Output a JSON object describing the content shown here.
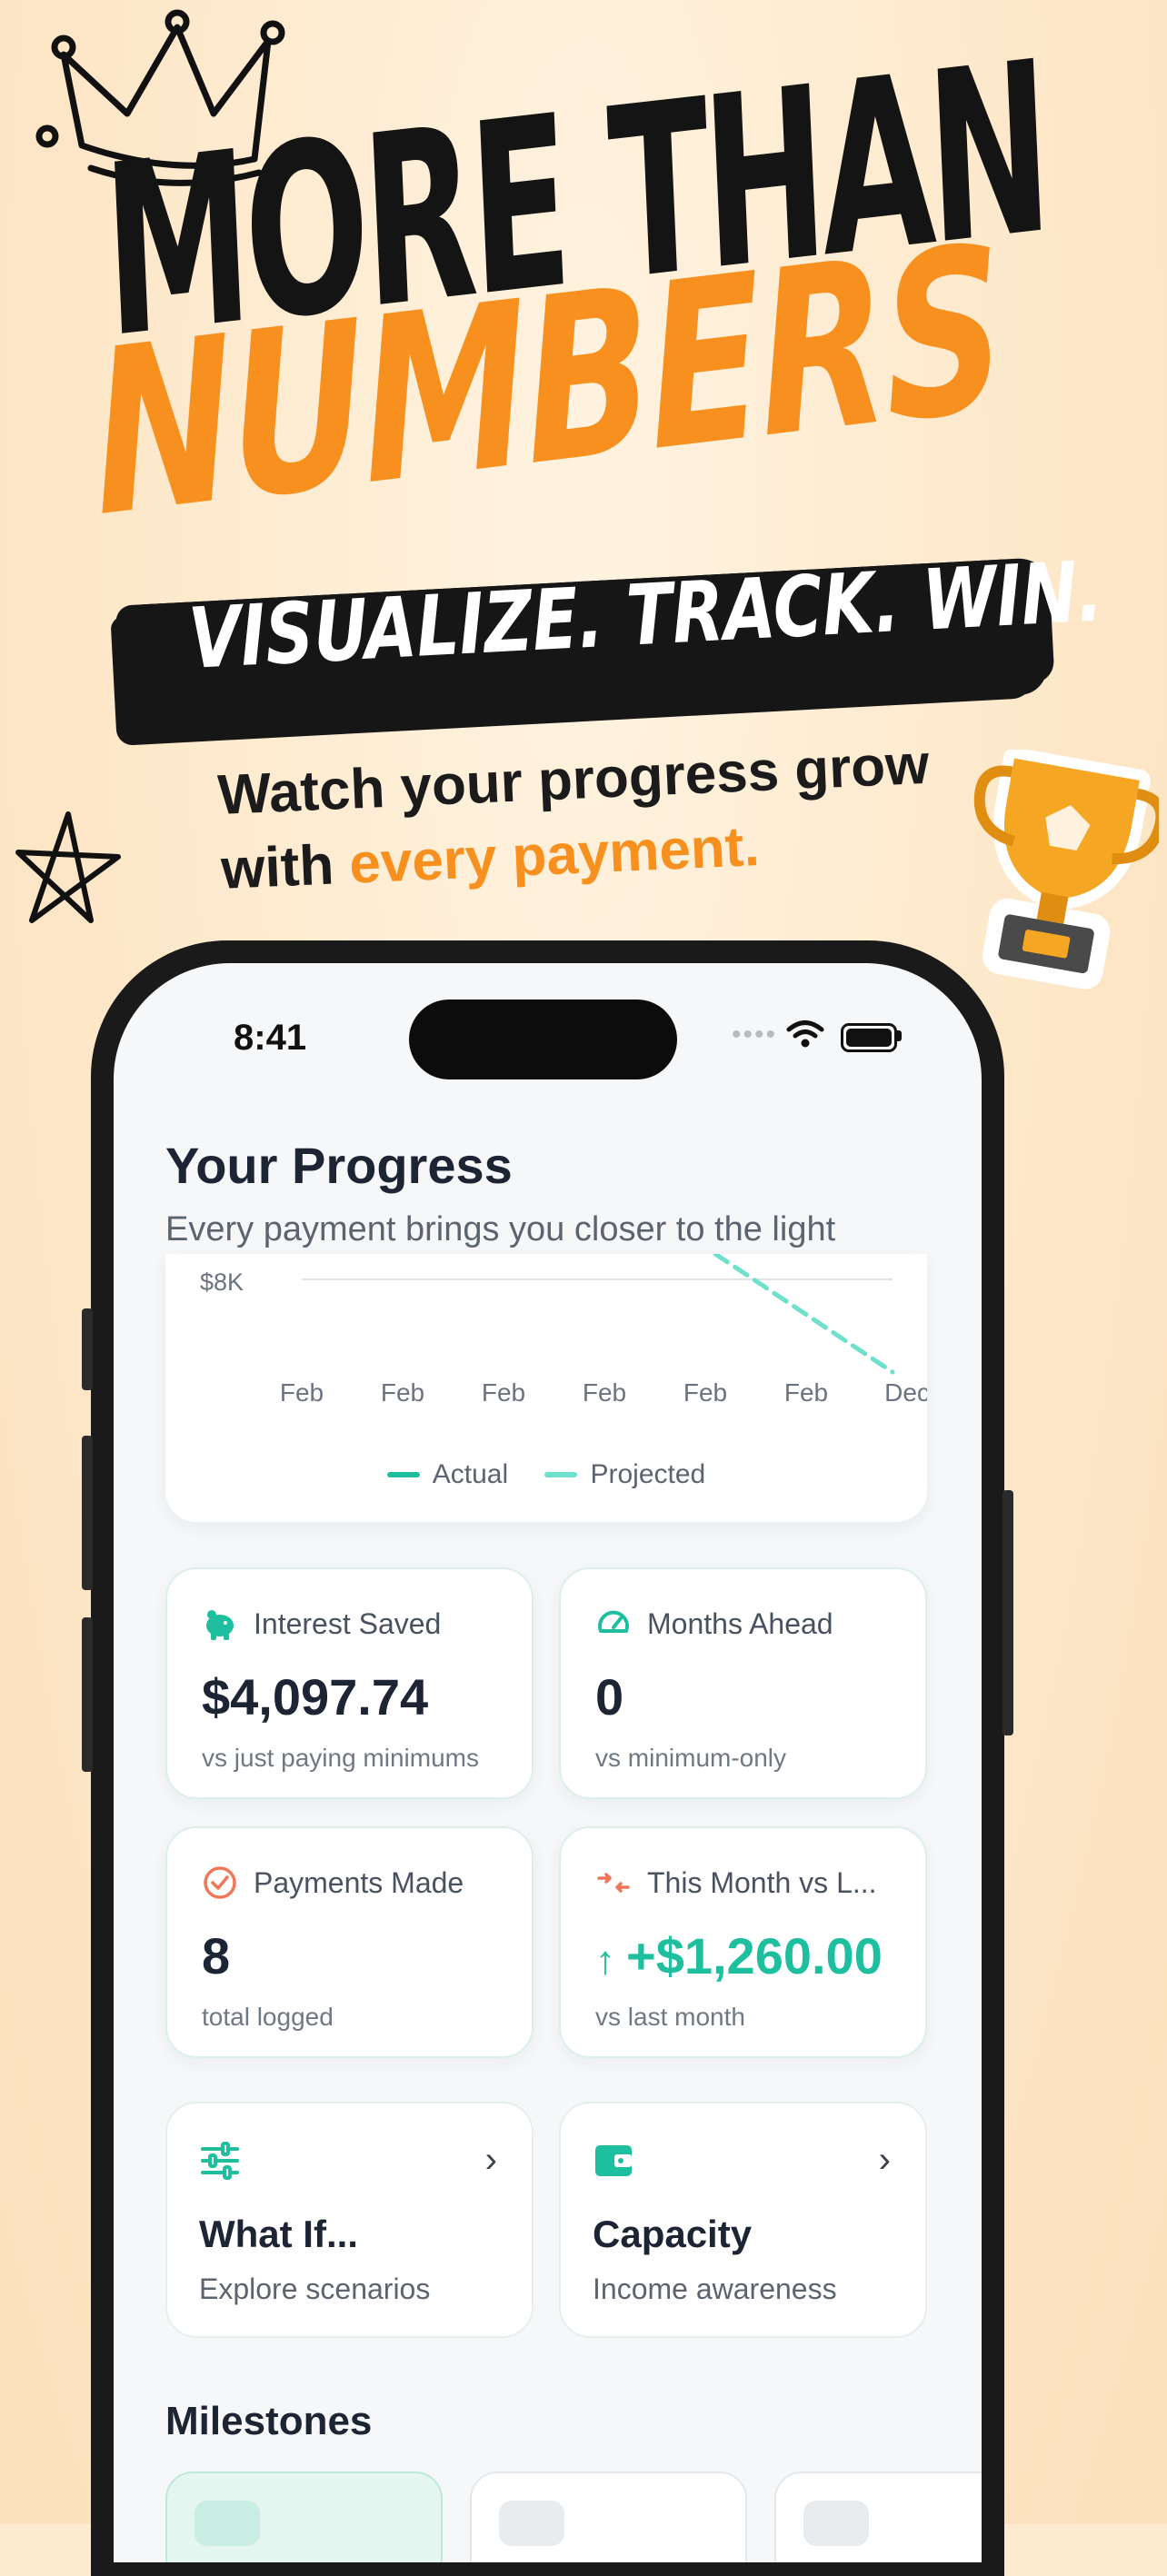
{
  "headline": {
    "line1": "MORE THAN",
    "line2": "NUMBERS",
    "tagline": "VISUALIZE. TRACK. WIN.",
    "sub_line1": "Watch your progress grow",
    "sub_line2_prefix": "with ",
    "sub_line2_highlight": "every payment."
  },
  "decorations": [
    "crown-doodle-icon",
    "star-doodle-icon",
    "trophy-sticker-icon"
  ],
  "colors": {
    "background": "#fdebcf",
    "accent_orange": "#f7901e",
    "teal": "#1dbf9f",
    "dark": "#1d2433"
  },
  "status_bar": {
    "time": "8:41",
    "icons": [
      "signal-dots-icon",
      "wifi-icon",
      "battery-icon"
    ]
  },
  "page": {
    "title": "Your Progress",
    "subtitle": "Every payment brings you closer to the light"
  },
  "chart_data": {
    "type": "line",
    "ytick_labels": [
      "$8K"
    ],
    "x": [
      "Feb",
      "Feb",
      "Feb",
      "Feb",
      "Feb",
      "Feb",
      "Dec"
    ],
    "series": [
      {
        "name": "Actual",
        "color": "#1dbf9f",
        "style": "solid"
      },
      {
        "name": "Projected",
        "color": "#6fe0cc",
        "style": "dashed"
      }
    ],
    "legend": "bottom-center"
  },
  "stats": [
    {
      "icon": "piggy-bank-icon",
      "label": "Interest Saved",
      "value": "$4,097.74",
      "note": "vs just paying minimums"
    },
    {
      "icon": "speedometer-icon",
      "label": "Months Ahead",
      "value": "0",
      "note": "vs minimum-only"
    },
    {
      "icon": "check-circle-icon",
      "label": "Payments Made",
      "value": "8",
      "note": "total logged"
    },
    {
      "icon": "compare-arrows-icon",
      "label": "This Month vs L...",
      "value": "+$1,260.00",
      "note": "vs last month"
    }
  ],
  "nav_cards": [
    {
      "icon": "sliders-icon",
      "title": "What If...",
      "subtitle": "Explore scenarios"
    },
    {
      "icon": "wallet-icon",
      "title": "Capacity",
      "subtitle": "Income awareness"
    }
  ],
  "milestones": {
    "title": "Milestones"
  }
}
